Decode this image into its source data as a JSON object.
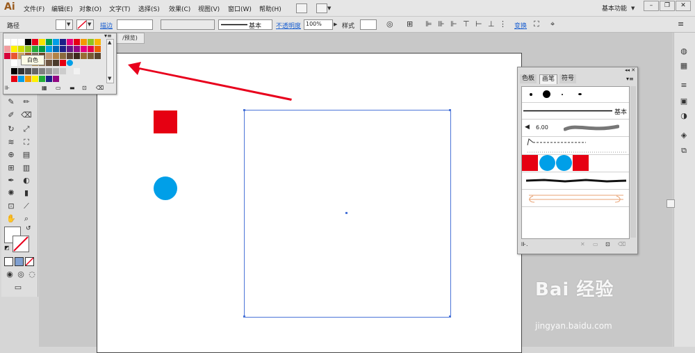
{
  "app": {
    "logo": "Ai"
  },
  "menu": [
    "文件(F)",
    "编辑(E)",
    "对象(O)",
    "文字(T)",
    "选择(S)",
    "效果(C)",
    "视图(V)",
    "窗口(W)",
    "帮助(H)"
  ],
  "workspace": {
    "label": "基本功能"
  },
  "window_controls": {
    "minimize": "–",
    "restore": "❐",
    "close": "✕"
  },
  "control_bar": {
    "object_type": "路径",
    "stroke_label": "描边",
    "stroke_style": "基本",
    "opacity_label": "不透明度",
    "opacity_value": "100%",
    "style_label": "样式",
    "transform_label": "变换"
  },
  "document": {
    "tab_label": "/预览)"
  },
  "swatch_panel": {
    "tooltip": "白色",
    "rows": [
      [
        "#ffffff",
        "#ffffff",
        "#ffffff",
        "#000000",
        "#e8001c",
        "#f5e300",
        "#00a050",
        "#009fe8",
        "#1d2088",
        "#e4007f",
        "#e60012",
        "#f39800",
        "#8fc31f",
        "#f8b500"
      ],
      [
        "#f29c9f",
        "#fff100",
        "#cfdb00",
        "#8fc31f",
        "#22ac38",
        "#009944",
        "#00a0e9",
        "#0068b7",
        "#1d2088",
        "#601986",
        "#920783",
        "#e4007f",
        "#e5004f",
        "#eb6100"
      ],
      [
        "#d7003a",
        "#ea5532",
        "#c9a063",
        "#a0522d",
        "#7e6b5a",
        "#6b4423",
        "#c39b77",
        "#b28247",
        "#8b6a3e",
        "#5c4033",
        "#3f2b1d",
        "#996c33",
        "#7b5b34",
        "#59442d"
      ],
      [
        "#ffffff",
        "#eeeeee",
        "#dddddd",
        "#c6a05a",
        "#997b52",
        "#6d5540",
        "#4b3b2c",
        "#e60012",
        "#009fe8"
      ],
      [
        "#000000",
        "#333333",
        "#4d4d4d",
        "#666666",
        "#808080",
        "#999999",
        "#b3b3b3",
        "#cccccc",
        "#e6e6e6",
        "#f2f2f2"
      ],
      [
        "#e60012",
        "#009fe8",
        "#f39800",
        "#fff100",
        "#22ac38",
        "#1d2088",
        "#920783"
      ]
    ]
  },
  "brush_panel": {
    "tabs": [
      "色板",
      "画笔",
      "符号"
    ],
    "active_tab": "画笔",
    "basic_label": "基本",
    "size_label": "6.00"
  },
  "canvas": {
    "red_square_color": "#e60012",
    "blue_circle_color": "#009fe8",
    "selection_color": "#4a74d8",
    "arrow_color": "#e8001c"
  },
  "watermark": {
    "brand": "Bai 经验",
    "url": "jingyan.baidu.com"
  }
}
